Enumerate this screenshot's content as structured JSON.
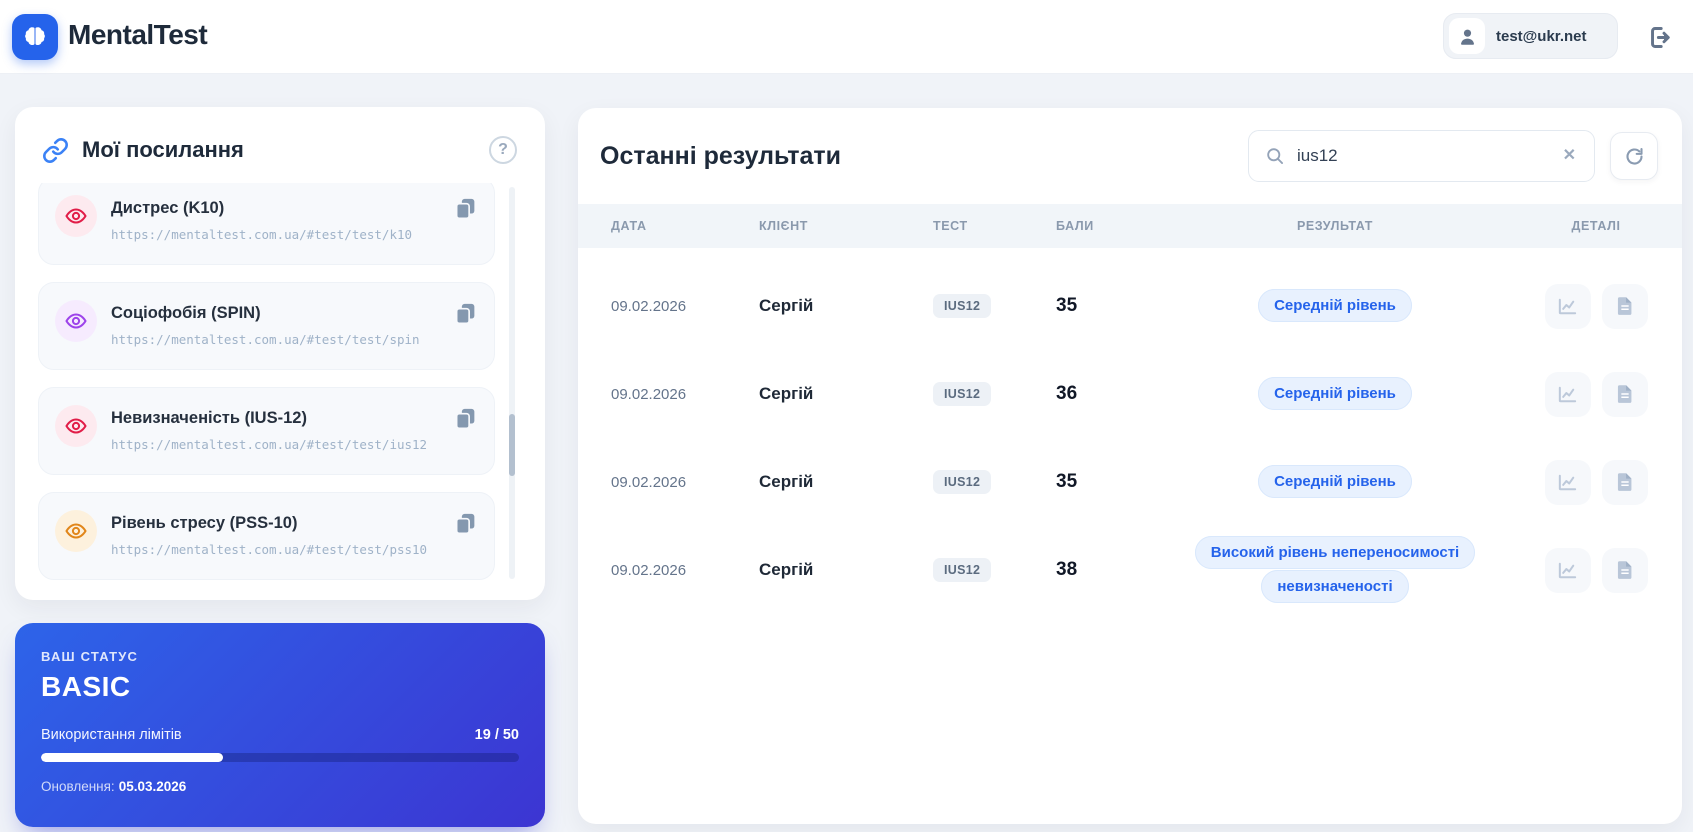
{
  "header": {
    "app_title": "MentalTest",
    "user_email": "test@ukr.net"
  },
  "icons": {
    "logo": "brain-icon",
    "links_header": "chain-link-icon",
    "help": "question-circle-icon",
    "list_item": "eye-icon",
    "copy": "copy-icon",
    "user": "person-icon",
    "logout": "sign-out-icon",
    "search": "magnifier-icon",
    "clear": "x-icon",
    "refresh": "rotate-cw-icon",
    "details_chart": "line-chart-icon",
    "details_report": "document-icon"
  },
  "colors": {
    "accent_blue": "#2563eb",
    "status_gradient_start": "#2d64e9",
    "status_gradient_end": "#3c35d2",
    "result_pill_bg": "#e8f1fe",
    "result_pill_text": "#2563eb"
  },
  "links_panel": {
    "title": "Мої посилання",
    "items": [
      {
        "name": "Дистрес (K10)",
        "url": "https://mentaltest.com.ua/#test/test/k10",
        "accent": "#e11d48",
        "accent_bg": "#fdeaef",
        "icon_style": "color:#e11d48;background:#fdeaef"
      },
      {
        "name": "Соціофобія (SPIN)",
        "url": "https://mentaltest.com.ua/#test/test/spin",
        "accent": "#9d43ea",
        "accent_bg": "#f6ebfe",
        "icon_style": "color:#9d43ea;background:#f6ebfe"
      },
      {
        "name": "Невизначеність (IUS-12)",
        "url": "https://mentaltest.com.ua/#test/test/ius12",
        "accent": "#e11d48",
        "accent_bg": "#fdeaef",
        "icon_style": "color:#e11d48;background:#fdeaef"
      },
      {
        "name": "Рівень стресу (PSS-10)",
        "url": "https://mentaltest.com.ua/#test/test/pss10",
        "accent": "#e1861a",
        "accent_bg": "#fdf1dd",
        "icon_style": "color:#e1861a;background:#fdf1dd"
      }
    ]
  },
  "status_card": {
    "label": "ВАШ СТАТУС",
    "plan": "BASIC",
    "usage_label": "Використання лімітів",
    "usage_value": "19 / 50",
    "usage_percent": 38,
    "usage_bar_style": "width:38%",
    "renewal_label": "Оновлення:",
    "renewal_date": "05.03.2026"
  },
  "results_panel": {
    "title": "Останні результати",
    "search_value": "ius12",
    "columns": [
      "ДАТА",
      "КЛІЄНТ",
      "ТЕСТ",
      "БАЛИ",
      "РЕЗУЛЬТАТ",
      "ДЕТАЛІ"
    ],
    "rows": [
      {
        "date": "09.02.2026",
        "client": "Сергій",
        "test": "IUS12",
        "score": "35",
        "result": "Середній рівень"
      },
      {
        "date": "09.02.2026",
        "client": "Сергій",
        "test": "IUS12",
        "score": "36",
        "result": "Середній рівень"
      },
      {
        "date": "09.02.2026",
        "client": "Сергій",
        "test": "IUS12",
        "score": "35",
        "result": "Середній рівень"
      },
      {
        "date": "09.02.2026",
        "client": "Сергій",
        "test": "IUS12",
        "score": "38",
        "result": "Високий рівень непереносимості невизначеності"
      }
    ]
  }
}
